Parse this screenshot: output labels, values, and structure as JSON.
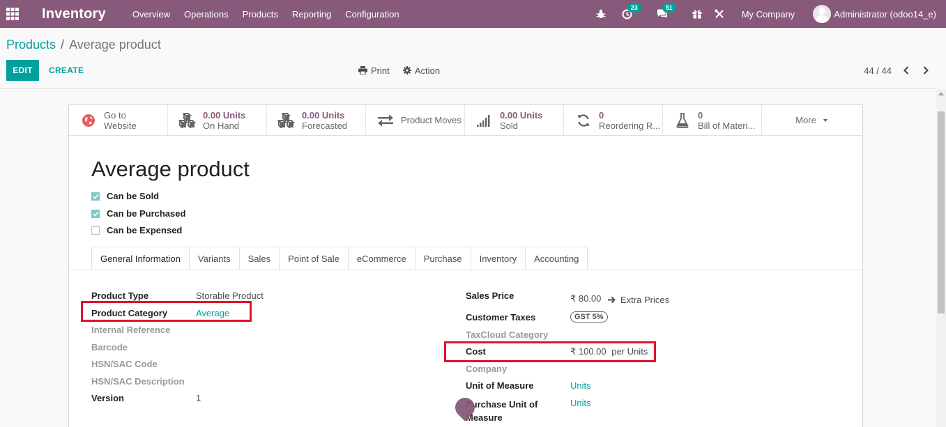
{
  "nav": {
    "app_name": "Inventory",
    "menu": [
      "Overview",
      "Operations",
      "Products",
      "Reporting",
      "Configuration"
    ],
    "activity_count": "23",
    "messages_count": "51",
    "company": "My Company",
    "user": "Administrator (odoo14_e)"
  },
  "breadcrumb": {
    "parent": "Products",
    "separator": "/",
    "current": "Average product"
  },
  "control": {
    "edit_label": "EDIT",
    "create_label": "CREATE",
    "print_label": "Print",
    "action_label": "Action",
    "pager": "44 / 44"
  },
  "smart_buttons": [
    {
      "value": "",
      "label": "Go to",
      "label2": "Website"
    },
    {
      "value": "0.00 Units",
      "label": "On Hand"
    },
    {
      "value": "0.00 Units",
      "label": "Forecasted"
    },
    {
      "value": "",
      "label": "Product Moves"
    },
    {
      "value": "0.00 Units",
      "label": "Sold"
    },
    {
      "value": "0",
      "label": "Reordering R..."
    },
    {
      "value": "0",
      "label": "Bill of Materi..."
    },
    {
      "label": "More"
    }
  ],
  "product": {
    "name": "Average product",
    "can_be_sold": {
      "label": "Can be Sold",
      "checked": true
    },
    "can_be_purchased": {
      "label": "Can be Purchased",
      "checked": true
    },
    "can_be_expensed": {
      "label": "Can be Expensed",
      "checked": false
    }
  },
  "tabs": [
    "General Information",
    "Variants",
    "Sales",
    "Point of Sale",
    "eCommerce",
    "Purchase",
    "Inventory",
    "Accounting"
  ],
  "left_fields": {
    "product_type": {
      "label": "Product Type",
      "value": "Storable Product"
    },
    "product_category": {
      "label": "Product Category",
      "value": "Average"
    },
    "internal_reference": {
      "label": "Internal Reference"
    },
    "barcode": {
      "label": "Barcode"
    },
    "hsn_code": {
      "label": "HSN/SAC Code"
    },
    "hsn_desc": {
      "label": "HSN/SAC Description"
    },
    "version": {
      "label": "Version",
      "value": "1"
    }
  },
  "right_fields": {
    "sales_price": {
      "label": "Sales Price",
      "value": "₹ 80.00",
      "extra": "Extra Prices"
    },
    "customer_taxes": {
      "label": "Customer Taxes",
      "value": "GST 5%"
    },
    "taxcloud": {
      "label": "TaxCloud Category"
    },
    "cost": {
      "label": "Cost",
      "value": "₹ 100.00",
      "unit": "per Units"
    },
    "company": {
      "label": "Company"
    },
    "uom": {
      "label": "Unit of Measure",
      "value": "Units"
    },
    "purchase_uom": {
      "label_line1": "Purchase Unit of",
      "label_line2": "Measure",
      "value": "Units"
    }
  },
  "colors": {
    "brand": "#875a7b",
    "accent": "#00a09d",
    "highlight": "#e2132a"
  }
}
